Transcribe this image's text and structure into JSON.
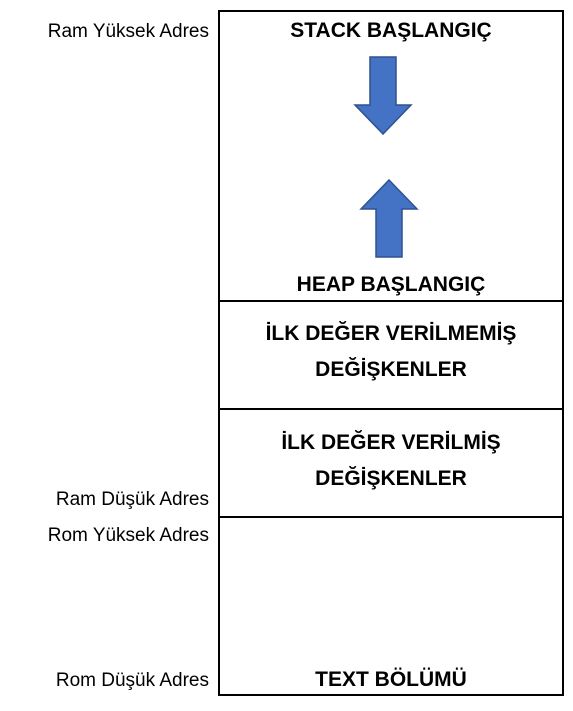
{
  "labels": {
    "ram_high": "Ram Yüksek Adres",
    "ram_low": "Ram Düşük Adres",
    "rom_high": "Rom Yüksek Adres",
    "rom_low": "Rom Düşük Adres"
  },
  "segments": {
    "stack_start": "STACK BAŞLANGIÇ",
    "heap_start": "HEAP BAŞLANGIÇ",
    "uninitialized_line1": "İLK DEĞER VERİLMEMİŞ",
    "uninitialized_line2": "DEĞİŞKENLER",
    "initialized_line1": "İLK DEĞER VERİLMİŞ",
    "initialized_line2": "DEĞİŞKENLER",
    "text_section": "TEXT BÖLÜMÜ"
  },
  "icons": {
    "down_arrow": "arrow-down-icon",
    "up_arrow": "arrow-up-icon"
  },
  "colors": {
    "arrow_fill": "#4472C4",
    "arrow_stroke": "#2F528F",
    "border": "#000000"
  }
}
